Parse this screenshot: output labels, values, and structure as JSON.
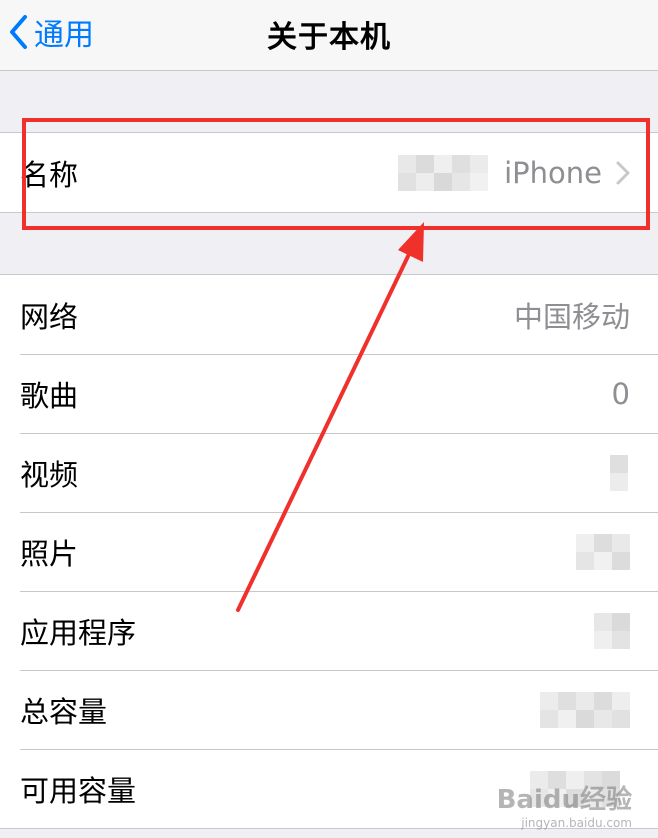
{
  "navbar": {
    "back_label": "通用",
    "title": "关于本机"
  },
  "name_row": {
    "label": "名称",
    "value": "iPhone"
  },
  "info_rows": [
    {
      "label": "网络",
      "value": "中国移动"
    },
    {
      "label": "歌曲",
      "value": "0"
    },
    {
      "label": "视频",
      "value": ""
    },
    {
      "label": "照片",
      "value": ""
    },
    {
      "label": "应用程序",
      "value": ""
    },
    {
      "label": "总容量",
      "value": ""
    },
    {
      "label": "可用容量",
      "value": ""
    }
  ],
  "annotation": {
    "highlight_color": "#f0302a"
  },
  "watermark": {
    "text": "Baidu经验",
    "sub": "jingyan.baidu.com"
  },
  "colors": {
    "accent": "#007aff",
    "secondary_text": "#8e8e93"
  }
}
